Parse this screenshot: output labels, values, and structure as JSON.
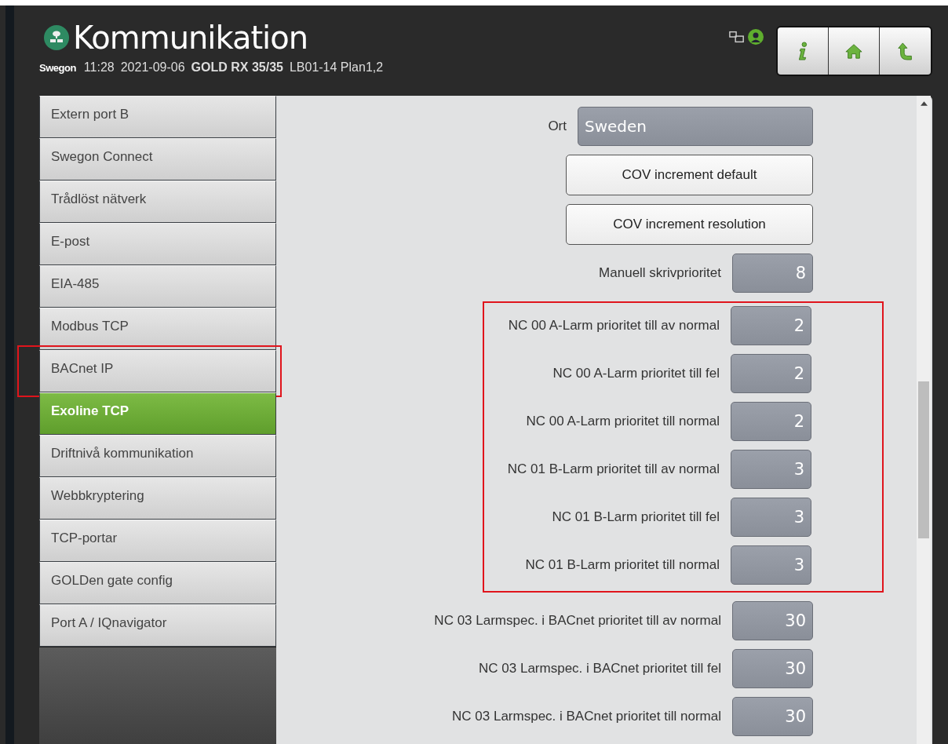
{
  "header": {
    "title": "Kommunikation",
    "brand": "Swegon",
    "time": "11:28",
    "date": "2021-09-06",
    "unit": "GOLD RX 35/35",
    "location": "LB01-14 Plan1,2"
  },
  "toolbar": [
    {
      "kind": "info"
    },
    {
      "kind": "home"
    },
    {
      "kind": "back"
    }
  ],
  "sidebar": {
    "items": [
      {
        "label": "Extern port B",
        "selected": false,
        "highlighted": false
      },
      {
        "label": "Swegon Connect",
        "selected": false,
        "highlighted": false
      },
      {
        "label": "Trådlöst nätverk",
        "selected": false,
        "highlighted": false
      },
      {
        "label": "E-post",
        "selected": false,
        "highlighted": false
      },
      {
        "label": "EIA-485",
        "selected": false,
        "highlighted": false
      },
      {
        "label": "Modbus TCP",
        "selected": false,
        "highlighted": false
      },
      {
        "label": "BACnet IP",
        "selected": false,
        "highlighted": true
      },
      {
        "label": "Exoline TCP",
        "selected": true,
        "highlighted": false
      },
      {
        "label": "Driftnivå kommunikation",
        "selected": false,
        "highlighted": false
      },
      {
        "label": "Webbkryptering",
        "selected": false,
        "highlighted": false
      },
      {
        "label": "TCP-portar",
        "selected": false,
        "highlighted": false
      },
      {
        "label": "GOLDen gate config",
        "selected": false,
        "highlighted": false
      },
      {
        "label": "Port A / IQnavigator",
        "selected": false,
        "highlighted": false
      }
    ]
  },
  "settings": [
    {
      "kind": "text",
      "label": "Ort",
      "value": "Sweden"
    },
    {
      "kind": "button",
      "label": "COV increment default"
    },
    {
      "kind": "button",
      "label": "COV increment resolution"
    },
    {
      "kind": "number",
      "label": "Manuell skrivprioritet",
      "value": "8"
    },
    {
      "kind": "group",
      "highlighted": true,
      "children": [
        {
          "kind": "number",
          "label": "NC 00 A-Larm prioritet till av normal",
          "value": "2"
        },
        {
          "kind": "number",
          "label": "NC 00 A-Larm prioritet till fel",
          "value": "2"
        },
        {
          "kind": "number",
          "label": "NC 00 A-Larm prioritet till normal",
          "value": "2"
        },
        {
          "kind": "number",
          "label": "NC 01 B-Larm prioritet till av normal",
          "value": "3"
        },
        {
          "kind": "number",
          "label": "NC 01 B-Larm prioritet till fel",
          "value": "3"
        },
        {
          "kind": "number",
          "label": "NC 01 B-Larm prioritet till normal",
          "value": "3"
        }
      ]
    },
    {
      "kind": "number",
      "label": "NC 03 Larmspec. i BACnet prioritet till av normal",
      "value": "30"
    },
    {
      "kind": "number",
      "label": "NC 03 Larmspec. i BACnet prioritet till fel",
      "value": "30"
    },
    {
      "kind": "number",
      "label": "NC 03 Larmspec. i BACnet prioritet till normal",
      "value": "30"
    }
  ]
}
